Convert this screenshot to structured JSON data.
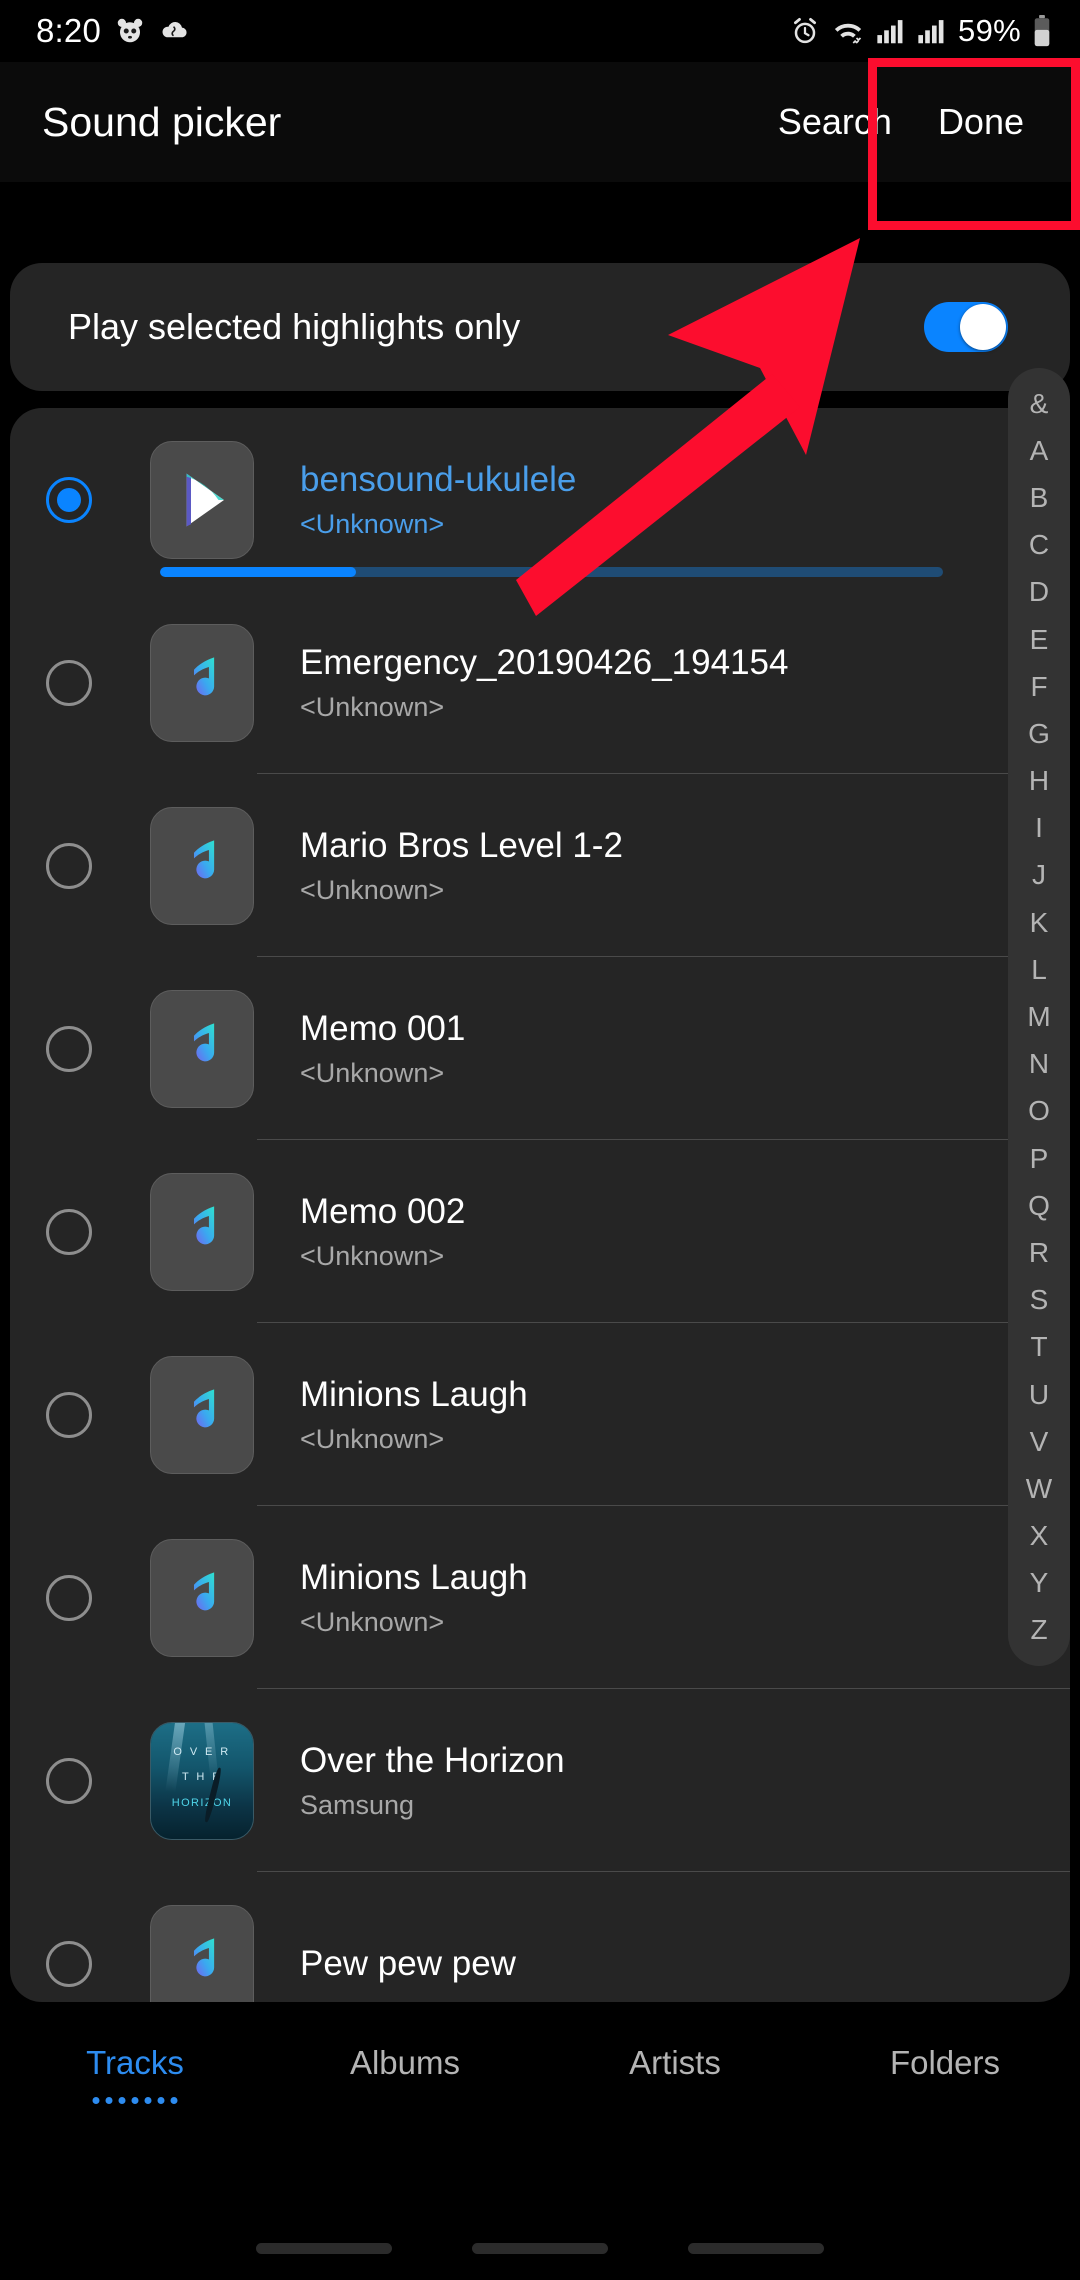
{
  "status_bar": {
    "time": "8:20",
    "battery_percent": "59%",
    "icons": [
      "panda-face-icon",
      "cloud-icon",
      "alarm-icon",
      "wifi-icon",
      "signal-sim1-icon",
      "signal-sim2-icon",
      "battery-icon"
    ]
  },
  "app_bar": {
    "title": "Sound picker",
    "search_label": "Search",
    "done_label": "Done"
  },
  "highlights": {
    "label": "Play selected highlights only",
    "toggle_on": true,
    "toggle_color": "#0a84ff"
  },
  "list": {
    "items": [
      {
        "title": "bensound-ukulele",
        "subtitle": "<Unknown>",
        "selected": true,
        "playing": true,
        "thumb": "play-icon",
        "progress_percent": 25
      },
      {
        "title": "Emergency_20190426_194154",
        "subtitle": "<Unknown>",
        "selected": false,
        "playing": false,
        "thumb": "music-note-icon"
      },
      {
        "title": "Mario Bros Level 1-2",
        "subtitle": "<Unknown>",
        "selected": false,
        "playing": false,
        "thumb": "music-note-icon"
      },
      {
        "title": "Memo 001",
        "subtitle": "<Unknown>",
        "selected": false,
        "playing": false,
        "thumb": "music-note-icon"
      },
      {
        "title": "Memo 002",
        "subtitle": "<Unknown>",
        "selected": false,
        "playing": false,
        "thumb": "music-note-icon"
      },
      {
        "title": "Minions Laugh",
        "subtitle": "<Unknown>",
        "selected": false,
        "playing": false,
        "thumb": "music-note-icon"
      },
      {
        "title": "Minions Laugh",
        "subtitle": "<Unknown>",
        "selected": false,
        "playing": false,
        "thumb": "music-note-icon"
      },
      {
        "title": "Over the Horizon",
        "subtitle": "Samsung",
        "selected": false,
        "playing": false,
        "thumb": "album-art-over-the-horizon"
      },
      {
        "title": "Pew pew pew",
        "subtitle": "",
        "selected": false,
        "playing": false,
        "thumb": "music-note-icon"
      }
    ],
    "album_art_text": {
      "line1": "O V E R",
      "line2": "T H E",
      "line3": "HORIZON"
    }
  },
  "alpha_index": [
    "&",
    "A",
    "B",
    "C",
    "D",
    "E",
    "F",
    "G",
    "H",
    "I",
    "J",
    "K",
    "L",
    "M",
    "N",
    "O",
    "P",
    "Q",
    "R",
    "S",
    "T",
    "U",
    "V",
    "W",
    "X",
    "Y",
    "Z"
  ],
  "tabs": [
    {
      "label": "Tracks",
      "active": true
    },
    {
      "label": "Albums",
      "active": false
    },
    {
      "label": "Artists",
      "active": false
    },
    {
      "label": "Folders",
      "active": false
    }
  ],
  "annotation": {
    "highlight_target": "Done",
    "color": "#fc0d2e"
  },
  "colors": {
    "accent": "#0a84ff",
    "tab_active": "#2d8cf0",
    "card_bg": "#252525",
    "screen_bg": "#000000",
    "annotation_red": "#fc0d2e"
  }
}
